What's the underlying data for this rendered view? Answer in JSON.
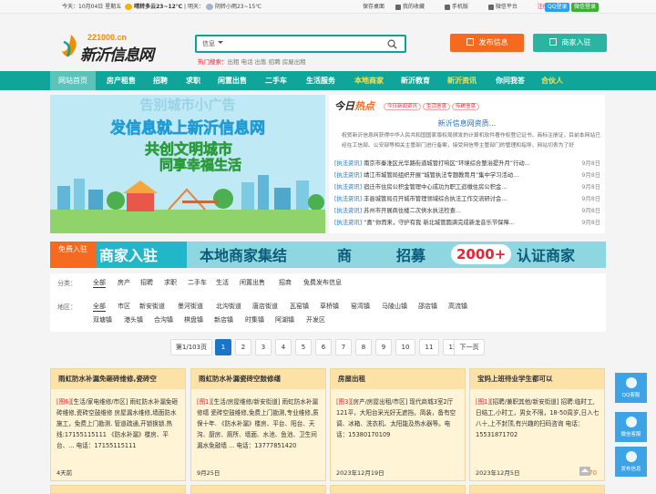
{
  "topbar": {
    "today": "今天：",
    "date": "10月04日 星期五",
    "weather_today": "晴转多云23~12℃",
    "tomorrow": "明天：",
    "weather_tomorrow": "阴转小雨23~15℃",
    "save_desktop": "保存桌面",
    "favorites": "我的收藏",
    "mobile": "手机版",
    "wechat": "微信平台",
    "register": "注册",
    "login": "登录",
    "qq_login": "QQ登录",
    "wechat_login": "微信登录"
  },
  "logo": {
    "domain": "221000.cn",
    "name": "新沂信息网"
  },
  "search": {
    "category": "信息",
    "placeholder": "",
    "hot_label": "热门搜索：",
    "hot_terms": "出租 电话 出售 招聘 房屋出租"
  },
  "buttons": {
    "publish": "发布信息",
    "merchant": "商家入驻"
  },
  "nav": [
    "网站首页",
    "房产租售",
    "招聘",
    "求职",
    "闲置出售",
    "二手车",
    "生活服务",
    "本地商家",
    "新沂教育",
    "新沂资讯",
    "你问我答",
    "合伙人"
  ],
  "banner": {
    "line0": "告别城市小广告",
    "line1": "发信息就上新沂信息网",
    "line2": "共创文明城市",
    "line3": "同享幸福生活"
  },
  "hot": {
    "title_a": "今日",
    "title_b": "热点",
    "tags": [
      "今日新闻资讯",
      "生活信息",
      "传统信息"
    ],
    "headline": "新沂信息网资质...",
    "desc": "祝贺新沂信息网获得中华人民共和国国家版权局颁发的计算机软件著作权登记证书、商标注册证，目前本网站已经在工信部、公安部等相关主管部门进行备案，接受网信等主管部门的管理和指导、网站切表为了好",
    "items": [
      {
        "tag": "[执法资讯]",
        "text": "南京市秦淮区光华路街道城管打响区“环境综合整治提升月”行动...",
        "date": "9月8日"
      },
      {
        "tag": "[执法资讯]",
        "text": "靖江市城管局组织开展“城管执法专题教育月”集中学习活动...",
        "date": "9月8日"
      },
      {
        "tag": "[执法资讯]",
        "text": "宿迁市住房公积金管理中心成功为职工追缴住房公积金...",
        "date": "9月8日"
      },
      {
        "tag": "[执法资讯]",
        "text": "丰县城管局召开城市管理领域综合执法工作交流研讨会...",
        "date": "9月8日"
      },
      {
        "tag": "[执法资讯]",
        "text": "苏州市开展商住楼二次供水执法检查...",
        "date": "9月8日"
      },
      {
        "tag": "[执法资讯]",
        "text": "“喜”你而来，守护有我 新北城管圆满完成新龙音乐节保障...",
        "date": "9月8日"
      }
    ]
  },
  "ad": {
    "free": "免费入驻",
    "merchant": "商家入驻",
    "local": "本地商家集结",
    "shop": "商",
    "recruit": "招募",
    "count": "2000+",
    "cert": "认证商家"
  },
  "filter": {
    "cat_label": "分类：",
    "cats": [
      "全部",
      "房产",
      "招聘",
      "求职",
      "二手车",
      "生活",
      "闲置出售",
      "招商",
      "免费发布信息"
    ],
    "area_label": "地区：",
    "areas1": [
      "全部",
      "市区",
      "新安街道",
      "墨河街道",
      "北沟街道",
      "唐店街道",
      "瓦窑镇",
      "草桥镇",
      "窑湾镇",
      "马陵山镇",
      "邵店镇",
      "高流镇"
    ],
    "areas2": [
      "双塘镇",
      "港头镇",
      "合沟镇",
      "棋盘镇",
      "新店镇",
      "时集镇",
      "阿湖镇",
      "开发区"
    ]
  },
  "pager": {
    "info": "第1/103页",
    "pages": [
      "1",
      "2",
      "3",
      "4",
      "5",
      "6",
      "7",
      "8",
      "9",
      "10",
      "11",
      "12"
    ],
    "next": "下一页"
  },
  "cards": [
    {
      "title": "雨虹防水补漏免砸砖维修,瓷砖空",
      "tag": "[图6]",
      "body": "[生活/家电维修/市区] 雨虹防水补漏免砸砖维修,瓷砖空鼓维修 房屋漏水维修,墙面防水施工，免费上门勘测. 管道疏通,开锁换锁.热线:17155115111 《防水补漏》楼房、平台、... 电话：17155115111",
      "time": "4天前",
      "price": ""
    },
    {
      "title": "雨虹防水补漏瓷砖空鼓修缮",
      "tag": "[图1]",
      "body": "[生活/房屋维修/新安街道] 雨虹防水补漏修缮 瓷砖空鼓维修,免费上门勘测,专业维修,质保十年. 《防水补漏》楼房、平台、阳台、天沟、厨房、厕所、墙面、水池、鱼池、卫生间漏水免敲墙 ... 电话：13777851420",
      "time": "9月25日",
      "price": ""
    },
    {
      "title": "房屋出租",
      "tag": "[图3]",
      "body": "[房产/房屋出租/市区] 现代商城3室2厅121平，大阳台采光好无遮挡，简装，备有空调、冰箱、洗衣机、太阳能及热水器等。电话：15380170109",
      "time": "2023年12月19日",
      "price": ""
    },
    {
      "title": "宝妈上班待业学生都可以",
      "tag": "[图1]",
      "body": "[招聘/兼职其他/新安街道] 招聘:临时工,日结工,小时工，男女不限，18-50周岁,日入七八十,上不封顶,有兴趣的扫码咨询 电话：15531871702",
      "time": "2023年12月5日",
      "price": "¥ 70"
    }
  ],
  "side": [
    "QQ客服",
    "微信客服",
    "发布信息"
  ]
}
